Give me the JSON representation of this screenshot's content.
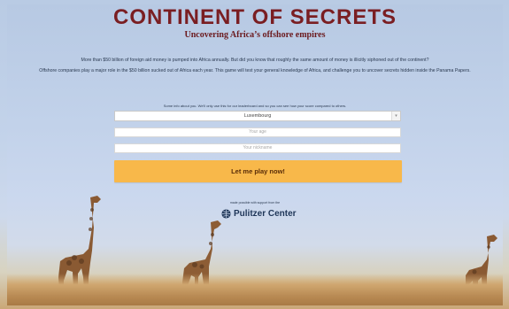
{
  "header": {
    "title": "CONTINENT OF SECRETS",
    "subtitle": "Uncovering Africa’s offshore empires"
  },
  "intro": {
    "line1": "More than $50 billion of foreign aid money is pumped into Africa annually. But did you know that roughly the same amount of money is illicitly siphoned out of the continent?",
    "line2": "Offshore companies play a major role in the $50 billion sucked out of Africa each year. This game will test your general knowledge of Africa, and challenge you to uncover secrets hidden inside the Panama Papers."
  },
  "form": {
    "info": "Some info about you. We'll only use this for our leaderboard and so you can see how your score compared to others.",
    "country_value": "Luxembourg",
    "age_placeholder": "Your age",
    "nickname_placeholder": "Your nickname",
    "play_label": "Let me play now!"
  },
  "sponsor": {
    "support_text": "made possible with support from the",
    "name": "Pulitzer Center"
  },
  "colors": {
    "title": "#7a1e22",
    "button": "#f8b84a",
    "sponsor": "#1f3658"
  }
}
